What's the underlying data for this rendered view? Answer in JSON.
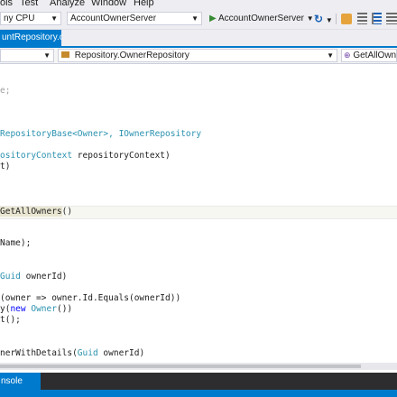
{
  "menu": {
    "items": [
      "ols",
      "Test",
      "Analyze",
      "Window",
      "Help"
    ]
  },
  "toolbar": {
    "platform": "ny CPU",
    "project": "AccountOwnerServer",
    "run_label": "AccountOwnerServer"
  },
  "tabs": {
    "active": "untRepository.cs"
  },
  "navbar": {
    "project": "",
    "type": "Repository.OwnerRepository",
    "member": "GetAllOwne"
  },
  "code": {
    "l1": "e;",
    "l2a": "RepositoryBase<",
    "l2b": "Owner",
    "l2c": ">, ",
    "l2d": "IOwnerRepository",
    "l3a": "ositoryContext",
    "l3b": " repositoryContext)",
    "l4": "t)",
    "l5a": "GetAllOwners",
    "l5b": "()",
    "l6": "Name);",
    "l7a": "Guid",
    "l7b": " ownerId)",
    "l8": "(owner => owner.Id.Equals(ownerId))",
    "l9a": "y(",
    "l9b": "new",
    "l9c": " ",
    "l9d": "Owner",
    "l9e": "())",
    "l10": "t();",
    "l11a": "nerWithDetails(",
    "l11b": "Guid",
    "l11c": " ownerId)"
  },
  "bottom": {
    "tab": "nsole"
  }
}
